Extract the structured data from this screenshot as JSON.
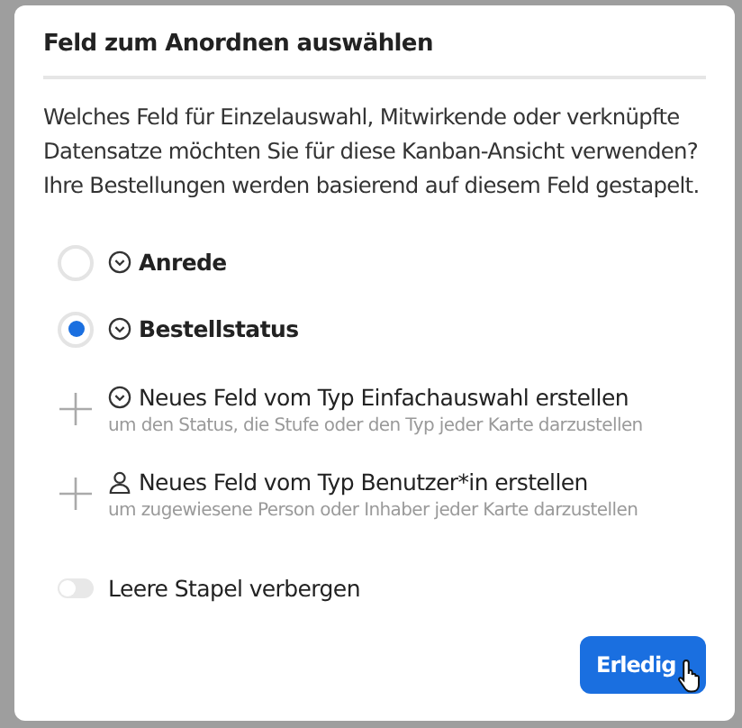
{
  "dialog": {
    "title": "Feld zum Anordnen auswählen",
    "description": "Welches Feld für Einzelauswahl, Mitwirkende oder verknüpfte Datensatze möchten Sie für diese Kanban-Ansicht verwenden? Ihre Bestellungen werden basierend auf diesem Feld gestapelt.",
    "options": [
      {
        "kind": "field",
        "label": "Anrede",
        "selected": false
      },
      {
        "kind": "field",
        "label": "Bestellstatus",
        "selected": true
      },
      {
        "kind": "choice",
        "label": "Neues Feld vom Typ Einfachauswahl erstellen",
        "hint": "um den Status, die Stufe oder den Typ jeder Karte darzustellen"
      },
      {
        "kind": "user",
        "label": "Neues Feld vom Typ Benutzer*in erstellen",
        "hint": "um zugewiesene Person oder Inhaber jeder Karte darzustellen"
      }
    ],
    "toggle": {
      "label": "Leere Stapel verbergen",
      "on": false
    },
    "button": {
      "label": "Erledig"
    }
  }
}
